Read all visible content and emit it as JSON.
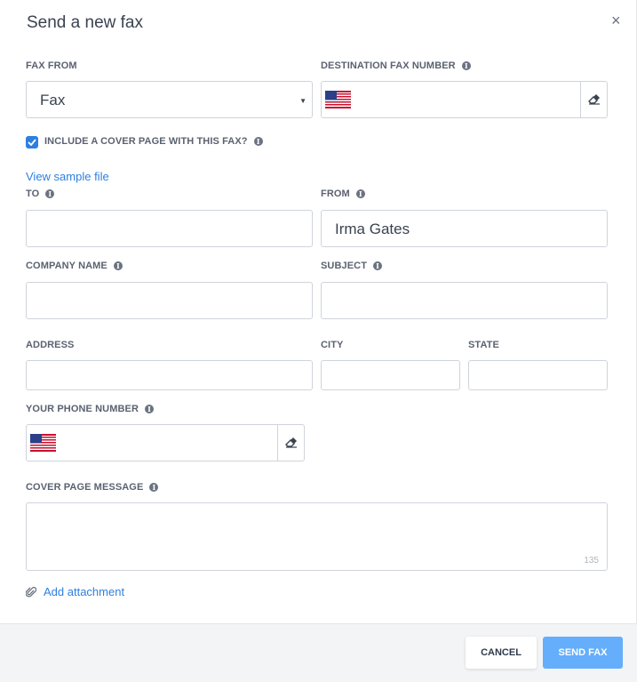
{
  "dialog": {
    "title": "Send a new fax",
    "close_label": "×"
  },
  "fax_from": {
    "label": "FAX FROM",
    "value": "Fax"
  },
  "destination": {
    "label": "DESTINATION FAX NUMBER",
    "value": ""
  },
  "cover_page": {
    "label": "INCLUDE A COVER PAGE WITH THIS FAX?",
    "checked": true
  },
  "view_sample": "View sample file",
  "to": {
    "label": "TO",
    "value": ""
  },
  "from": {
    "label": "FROM",
    "value": "Irma Gates"
  },
  "company": {
    "label": "COMPANY NAME",
    "value": ""
  },
  "subject": {
    "label": "SUBJECT",
    "value": ""
  },
  "address": {
    "label": "ADDRESS",
    "value": ""
  },
  "city": {
    "label": "CITY",
    "value": ""
  },
  "state": {
    "label": "STATE",
    "value": ""
  },
  "phone": {
    "label": "YOUR PHONE NUMBER",
    "value": ""
  },
  "message": {
    "label": "COVER PAGE MESSAGE",
    "value": "",
    "counter": "135"
  },
  "attachment": "Add attachment",
  "footer": {
    "cancel": "CANCEL",
    "send": "SEND FAX"
  },
  "colors": {
    "accent": "#2d7fe0",
    "send_button": "#64aefc"
  },
  "icons": [
    "close-icon",
    "info-icon",
    "chevron-down-icon",
    "us-flag-icon",
    "eraser-icon",
    "check-icon",
    "paperclip-icon"
  ]
}
